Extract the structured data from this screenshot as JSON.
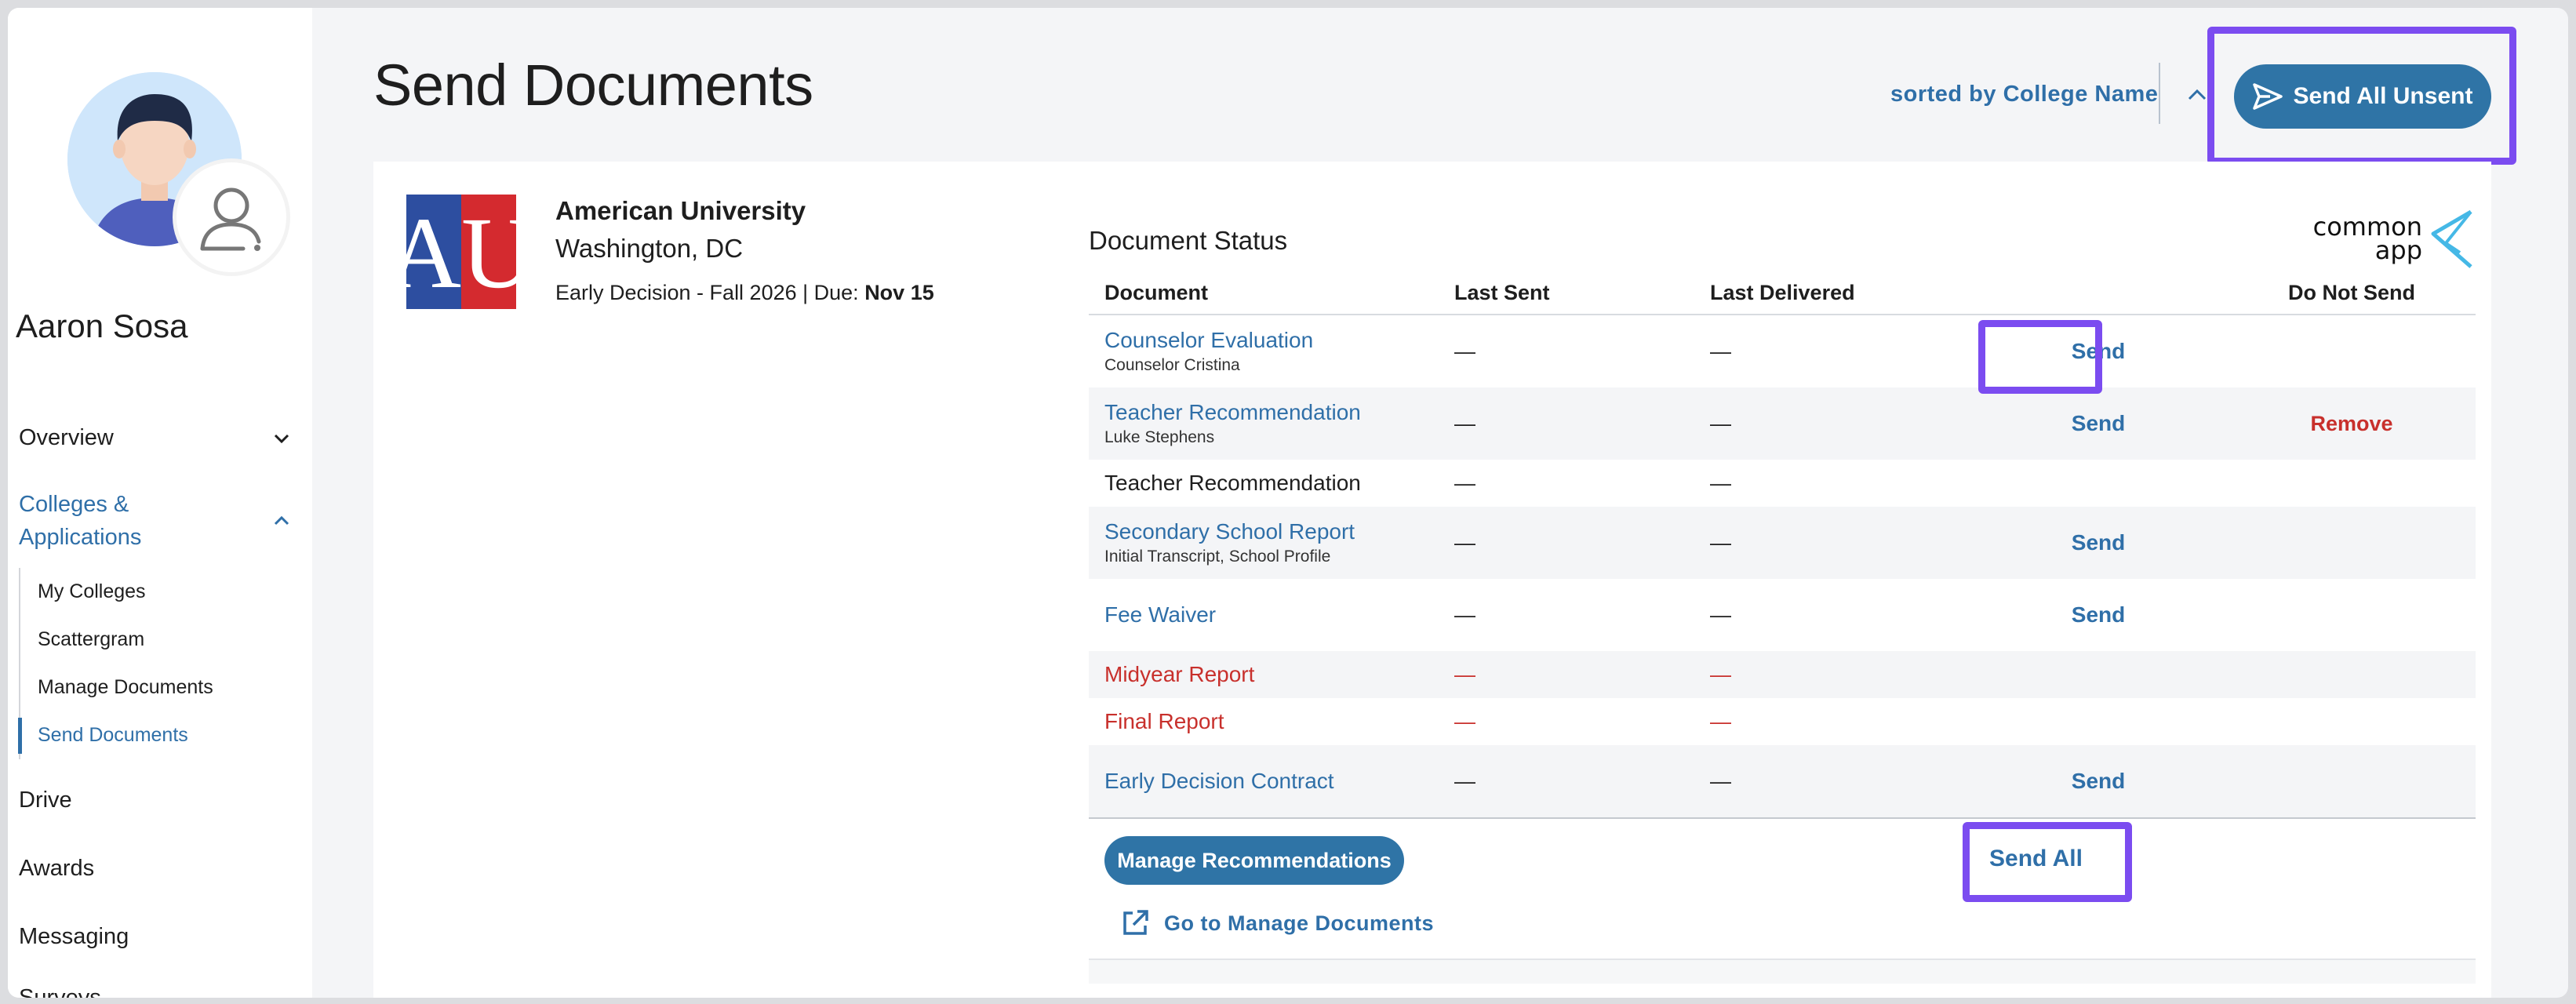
{
  "user": {
    "name": "Aaron Sosa"
  },
  "sidebar": {
    "items": [
      {
        "label": "Overview"
      },
      {
        "label": "Colleges & Applications"
      },
      {
        "label": "Drive"
      },
      {
        "label": "Awards"
      },
      {
        "label": "Messaging"
      },
      {
        "label": "Surveys"
      }
    ],
    "sub_items": [
      {
        "label": "My Colleges"
      },
      {
        "label": "Scattergram"
      },
      {
        "label": "Manage Documents"
      },
      {
        "label": "Send Documents"
      }
    ],
    "active_sub_item": "Send Documents"
  },
  "header": {
    "title": "Send Documents",
    "sort_label": "sorted by College Name",
    "send_all_unsent_label": "Send All Unsent"
  },
  "college": {
    "name": "American University",
    "location": "Washington, DC",
    "plan_prefix": "Early Decision - Fall 2026 | Due: ",
    "due_date": "Nov 15",
    "logo_text": "AU"
  },
  "documents": {
    "section_title": "Document Status",
    "brand": "common app",
    "brand_line1": "common",
    "brand_line2": "app",
    "headers": {
      "document": "Document",
      "last_sent": "Last Sent",
      "last_delivered": "Last Delivered",
      "send": "",
      "do_not_send": "Do Not Send"
    },
    "rows": [
      {
        "title": "Counselor Evaluation",
        "subtitle": "Counselor Cristina",
        "last_sent": "—",
        "last_delivered": "—",
        "send": "Send",
        "do_not_send": ""
      },
      {
        "title": "Teacher Recommendation",
        "subtitle": "Luke Stephens",
        "last_sent": "—",
        "last_delivered": "—",
        "send": "Send",
        "do_not_send": "Remove"
      },
      {
        "title": "Teacher Recommendation",
        "subtitle": "",
        "last_sent": "—",
        "last_delivered": "—",
        "send": "",
        "do_not_send": ""
      },
      {
        "title": "Secondary School Report",
        "subtitle": "Initial Transcript, School Profile",
        "last_sent": "—",
        "last_delivered": "—",
        "send": "Send",
        "do_not_send": ""
      },
      {
        "title": "Fee Waiver",
        "subtitle": "",
        "last_sent": "—",
        "last_delivered": "—",
        "send": "Send",
        "do_not_send": ""
      },
      {
        "title": "Midyear Report",
        "subtitle": "",
        "last_sent": "—",
        "last_delivered": "—",
        "send": "",
        "do_not_send": ""
      },
      {
        "title": "Final Report",
        "subtitle": "",
        "last_sent": "—",
        "last_delivered": "—",
        "send": "",
        "do_not_send": ""
      },
      {
        "title": "Early Decision Contract",
        "subtitle": "",
        "last_sent": "—",
        "last_delivered": "—",
        "send": "Send",
        "do_not_send": ""
      }
    ],
    "manage_recommendations_label": "Manage Recommendations",
    "send_all_label": "Send All",
    "go_manage_label": "Go to Manage Documents"
  },
  "colors": {
    "accent": "#2f74a6",
    "link": "#2f6fa8",
    "alert": "#c8302c",
    "highlight": "#7b4cf0"
  },
  "icons": [
    "chevron-down-icon",
    "chevron-up-icon",
    "send-icon",
    "external-link-icon",
    "user-role-icon"
  ]
}
